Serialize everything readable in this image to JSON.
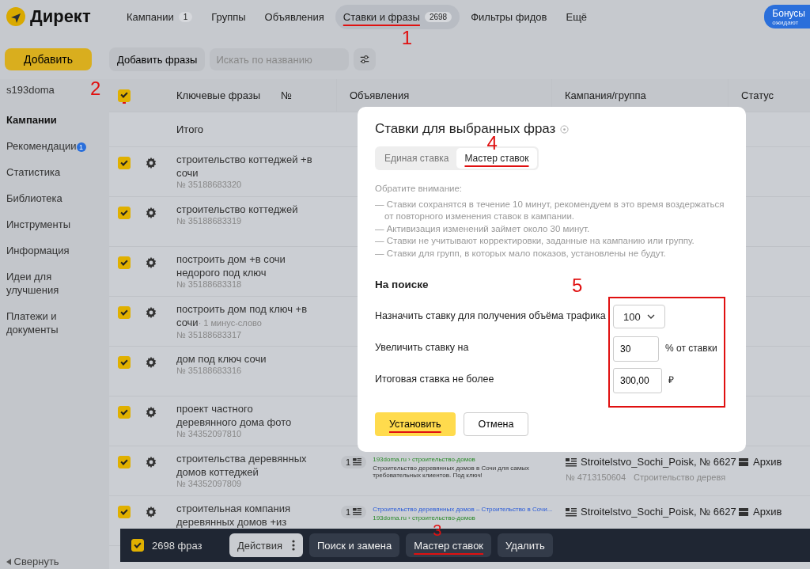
{
  "header": {
    "logo": "Директ",
    "nav": [
      {
        "label": "Кампании",
        "count": "1",
        "selected": false
      },
      {
        "label": "Группы",
        "selected": false
      },
      {
        "label": "Объявления",
        "selected": false
      },
      {
        "label": "Ставки и фразы",
        "count": "2698",
        "selected": true,
        "annotation": "1"
      },
      {
        "label": "Фильтры фидов",
        "selected": false
      },
      {
        "label": "Ещё",
        "selected": false
      }
    ],
    "bonus": {
      "label": "Бонусы",
      "sublabel": "ожидают"
    }
  },
  "toolbar": {
    "add_button": "Добавить",
    "add_phrases_button": "Добавить фразы",
    "search": {
      "placeholder": "Искать по названию"
    }
  },
  "sidebar": {
    "account": "s193doma",
    "items": [
      {
        "label": "Кампании",
        "selected": true
      },
      {
        "label": "Рекомендации",
        "badge": "1",
        "selected": false
      },
      {
        "label": "Статистика",
        "selected": false
      },
      {
        "label": "Библиотека",
        "selected": false
      },
      {
        "label": "Инструменты",
        "selected": false
      },
      {
        "label": "Информация",
        "selected": false
      },
      {
        "label": "Идеи для улучшения",
        "selected": false
      },
      {
        "label": "Платежи и документы",
        "selected": false
      }
    ],
    "collapse": "Свернуть"
  },
  "table": {
    "columns": [
      "Ключевые фразы",
      "№",
      "Объявления",
      "Кампания/группа",
      "Статус"
    ],
    "header_checkbox": {
      "checked": true,
      "annotation": "2"
    },
    "total_label": "Итого",
    "rows": [
      {
        "checked": true,
        "phrase": "строительство коттеджей +в сочи",
        "id": "№ 35188683320"
      },
      {
        "checked": true,
        "phrase": "строительство коттеджей",
        "id": "№ 35188683319"
      },
      {
        "checked": true,
        "phrase": "построить дом +в сочи недорого под ключ",
        "id": "№ 35188683318"
      },
      {
        "checked": true,
        "phrase": "построить дом под ключ +в сочи",
        "note": "· 1 минус-слово",
        "id": "№ 35188683317"
      },
      {
        "checked": true,
        "phrase": "дом под ключ сочи",
        "id": "№ 35188683316"
      },
      {
        "checked": true,
        "phrase": "проект частного деревянного дома фото",
        "id": "№ 34352097810"
      },
      {
        "checked": true,
        "phrase": "строительства деревянных домов коттеджей",
        "id": "№ 34352097809",
        "ad": {
          "count": "1",
          "domain": "193doma.ru › строительство-домов",
          "text": "Строительство деревянных домов в Сочи для самых требовательных клиентов. Под ключ!"
        },
        "campaign": {
          "name": "Stroitelstvo_Sochi_Poisk, № 6627",
          "id": "№ 4713150604",
          "group": "Строительство деревя"
        },
        "status": "Архив"
      },
      {
        "checked": true,
        "phrase": "строительная компания деревянных домов +из",
        "ad": {
          "count": "1",
          "title": "Строительство деревянных домов – Строительство в Сочи...",
          "domain": "193doma.ru › строительство-домов"
        },
        "campaign": {
          "name": "Stroitelstvo_Sochi_Poisk, № 6627"
        },
        "status": "Архив"
      }
    ]
  },
  "modal": {
    "title": "Ставки для выбранных фраз",
    "tabs": [
      {
        "label": "Единая ставка",
        "selected": false
      },
      {
        "label": "Мастер ставок",
        "selected": true,
        "annotation": "4"
      }
    ],
    "notice_title": "Обратите внимание:",
    "notices": [
      "— Ставки сохранятся в течение 10 минут, рекомендуем в это время воздержаться от повторного изменения ставок в кампании.",
      "— Активизация изменений займет около 30 минут.",
      "— Ставки не учитывают корректировки, заданные на кампанию или группу.",
      "— Ставки для групп, в которых мало показов, установлены не будут."
    ],
    "section_title": "На поиске",
    "annotation": "5",
    "fields": [
      {
        "kind": "select",
        "label": "Назначить ставку для получения объёма трафика",
        "value": "100"
      },
      {
        "kind": "input",
        "label": "Увеличить ставку на",
        "value": "30",
        "unit": "% от ставки"
      },
      {
        "kind": "input",
        "label": "Итоговая ставка не более",
        "value": "300,00",
        "unit": "₽"
      }
    ],
    "buttons": [
      {
        "label": "Установить",
        "kind": "primary",
        "underlined": true
      },
      {
        "label": "Отмена",
        "kind": "secondary",
        "underlined": false
      }
    ]
  },
  "bottom_bar": {
    "checkbox": {
      "checked": true
    },
    "count": "2698 фраз",
    "buttons": [
      {
        "label": "Действия",
        "kind": "menu"
      },
      {
        "label": "Поиск и замена",
        "kind": "plain"
      },
      {
        "label": "Мастер ставок",
        "kind": "plain",
        "annotation": "3"
      },
      {
        "label": "Удалить",
        "kind": "plain"
      }
    ]
  }
}
